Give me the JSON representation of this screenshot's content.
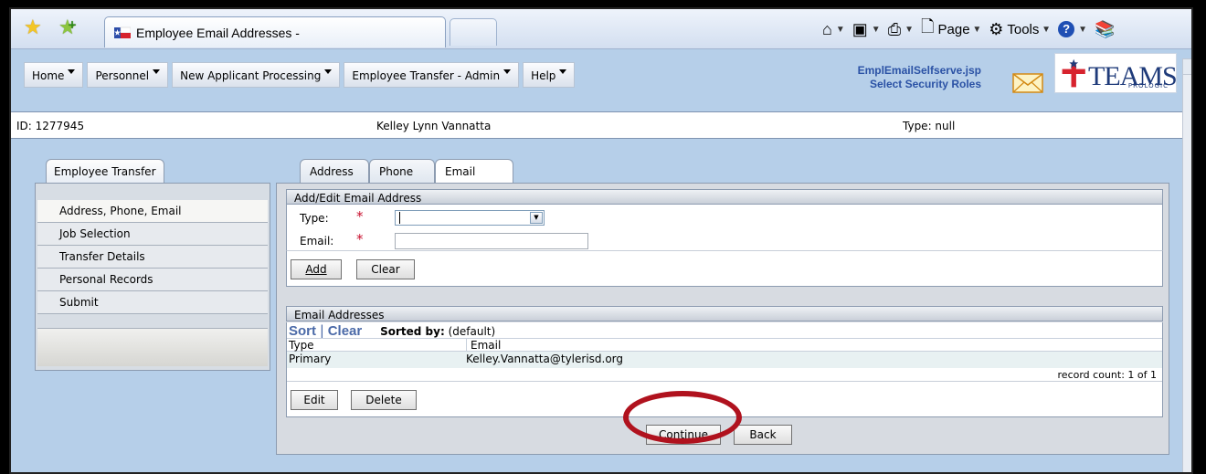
{
  "browser": {
    "tab_title": "Employee Email Addresses -",
    "toolbar": {
      "page_label": "Page",
      "tools_label": "Tools"
    }
  },
  "menu": {
    "items": [
      {
        "label": "Home"
      },
      {
        "label": "Personnel"
      },
      {
        "label": "New Applicant Processing"
      },
      {
        "label": "Employee Transfer - Admin"
      },
      {
        "label": "Help"
      }
    ]
  },
  "app_info": {
    "page_file": "EmplEmailSelfserve.jsp",
    "security_link": "Select Security Roles"
  },
  "logo": {
    "brand": "TEAMS",
    "sub": "PROLOGIC"
  },
  "id_bar": {
    "id": "ID: 1277945",
    "name": "Kelley Lynn Vannatta",
    "type": "Type: null"
  },
  "left": {
    "tab_label": "Employee Transfer",
    "nav": [
      {
        "label": "Address, Phone, Email"
      },
      {
        "label": "Job Selection"
      },
      {
        "label": "Transfer Details"
      },
      {
        "label": "Personal Records"
      },
      {
        "label": "Submit"
      }
    ]
  },
  "tabs": [
    {
      "label": "Address"
    },
    {
      "label": "Phone"
    },
    {
      "label": "Email"
    }
  ],
  "add_edit": {
    "title": "Add/Edit Email Address",
    "type_label": "Type:",
    "email_label": "Email:",
    "required_mark": "*",
    "type_value": "",
    "email_value": "",
    "add_label": "Add",
    "clear_label": "Clear"
  },
  "email_list": {
    "title": "Email Addresses",
    "sort_label": "Sort",
    "sort_sep": "|",
    "clear_label": "Clear",
    "sorted_by_label": "Sorted by:",
    "sorted_by_value": "(default)",
    "columns": [
      "Type",
      "Email"
    ],
    "rows": [
      {
        "type": "Primary",
        "email": "Kelley.Vannatta@tylerisd.org"
      }
    ],
    "record_count": "record count: 1 of 1",
    "edit_label": "Edit",
    "delete_label": "Delete"
  },
  "footer": {
    "continue_label": "Continue",
    "back_label": "Back"
  },
  "colors": {
    "page_bg": "#b6cfe9",
    "link_blue": "#2b52a5",
    "required_red": "#c8102e",
    "highlight_ring": "#b0121e"
  }
}
